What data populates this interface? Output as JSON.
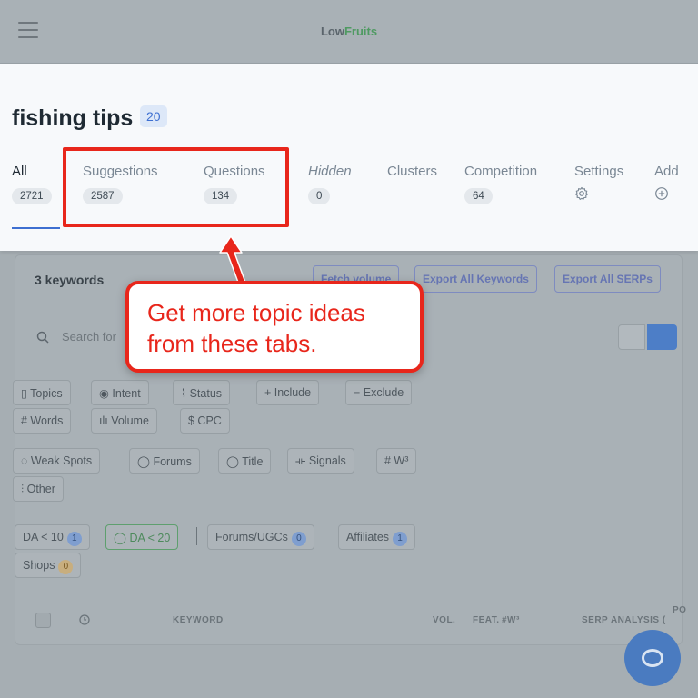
{
  "app": {
    "brand_part1": "Low",
    "brand_part2": "Fruits"
  },
  "header": {
    "title": "fishing tips",
    "title_count": "20",
    "tabs": [
      {
        "label": "All",
        "count": "2721"
      },
      {
        "label": "Suggestions",
        "count": "2587"
      },
      {
        "label": "Questions",
        "count": "134"
      },
      {
        "label": "Hidden",
        "count": "0"
      },
      {
        "label": "Clusters"
      },
      {
        "label": "Competition",
        "count": "64"
      },
      {
        "label": "Settings",
        "icon": "gear-icon"
      },
      {
        "label": "Add",
        "icon": "plus-circle-icon"
      }
    ]
  },
  "callout": {
    "text_line1": "Get more topic ideas",
    "text_line2": "from these tabs."
  },
  "toolbar": {
    "keywords_count": "3 keywords",
    "fetch_volume": "Fetch volume",
    "export_keywords": "Export All Keywords",
    "export_serps": "Export All SERPs"
  },
  "search": {
    "placeholder": "Search for"
  },
  "filters": {
    "row1": [
      "Topics",
      "Intent",
      "Status",
      "+ Include",
      "− Exclude"
    ],
    "row2": [
      "# Words",
      "Volume",
      "$ CPC"
    ],
    "row3": [
      "Weak Spots",
      "Forums",
      "Title",
      "Signals",
      "# W³"
    ],
    "row4": [
      "Other"
    ],
    "row5": [
      {
        "label": "DA < 10",
        "count": "1"
      },
      {
        "label": "DA < 20",
        "count": ""
      },
      {
        "label": "Forums/UGCs",
        "count": "0"
      },
      {
        "label": "Affiliates",
        "count": "1"
      }
    ],
    "row6": [
      {
        "label": "Shops",
        "count": "0"
      }
    ]
  },
  "table": {
    "columns": [
      "KEYWORD",
      "VOL.",
      "FEAT.",
      "#W³",
      "SERP ANALYSIS (",
      "PO"
    ]
  },
  "colors": {
    "accent": "#3d6fd1",
    "highlight": "#e8261b",
    "brand_green": "#4f9a62"
  }
}
